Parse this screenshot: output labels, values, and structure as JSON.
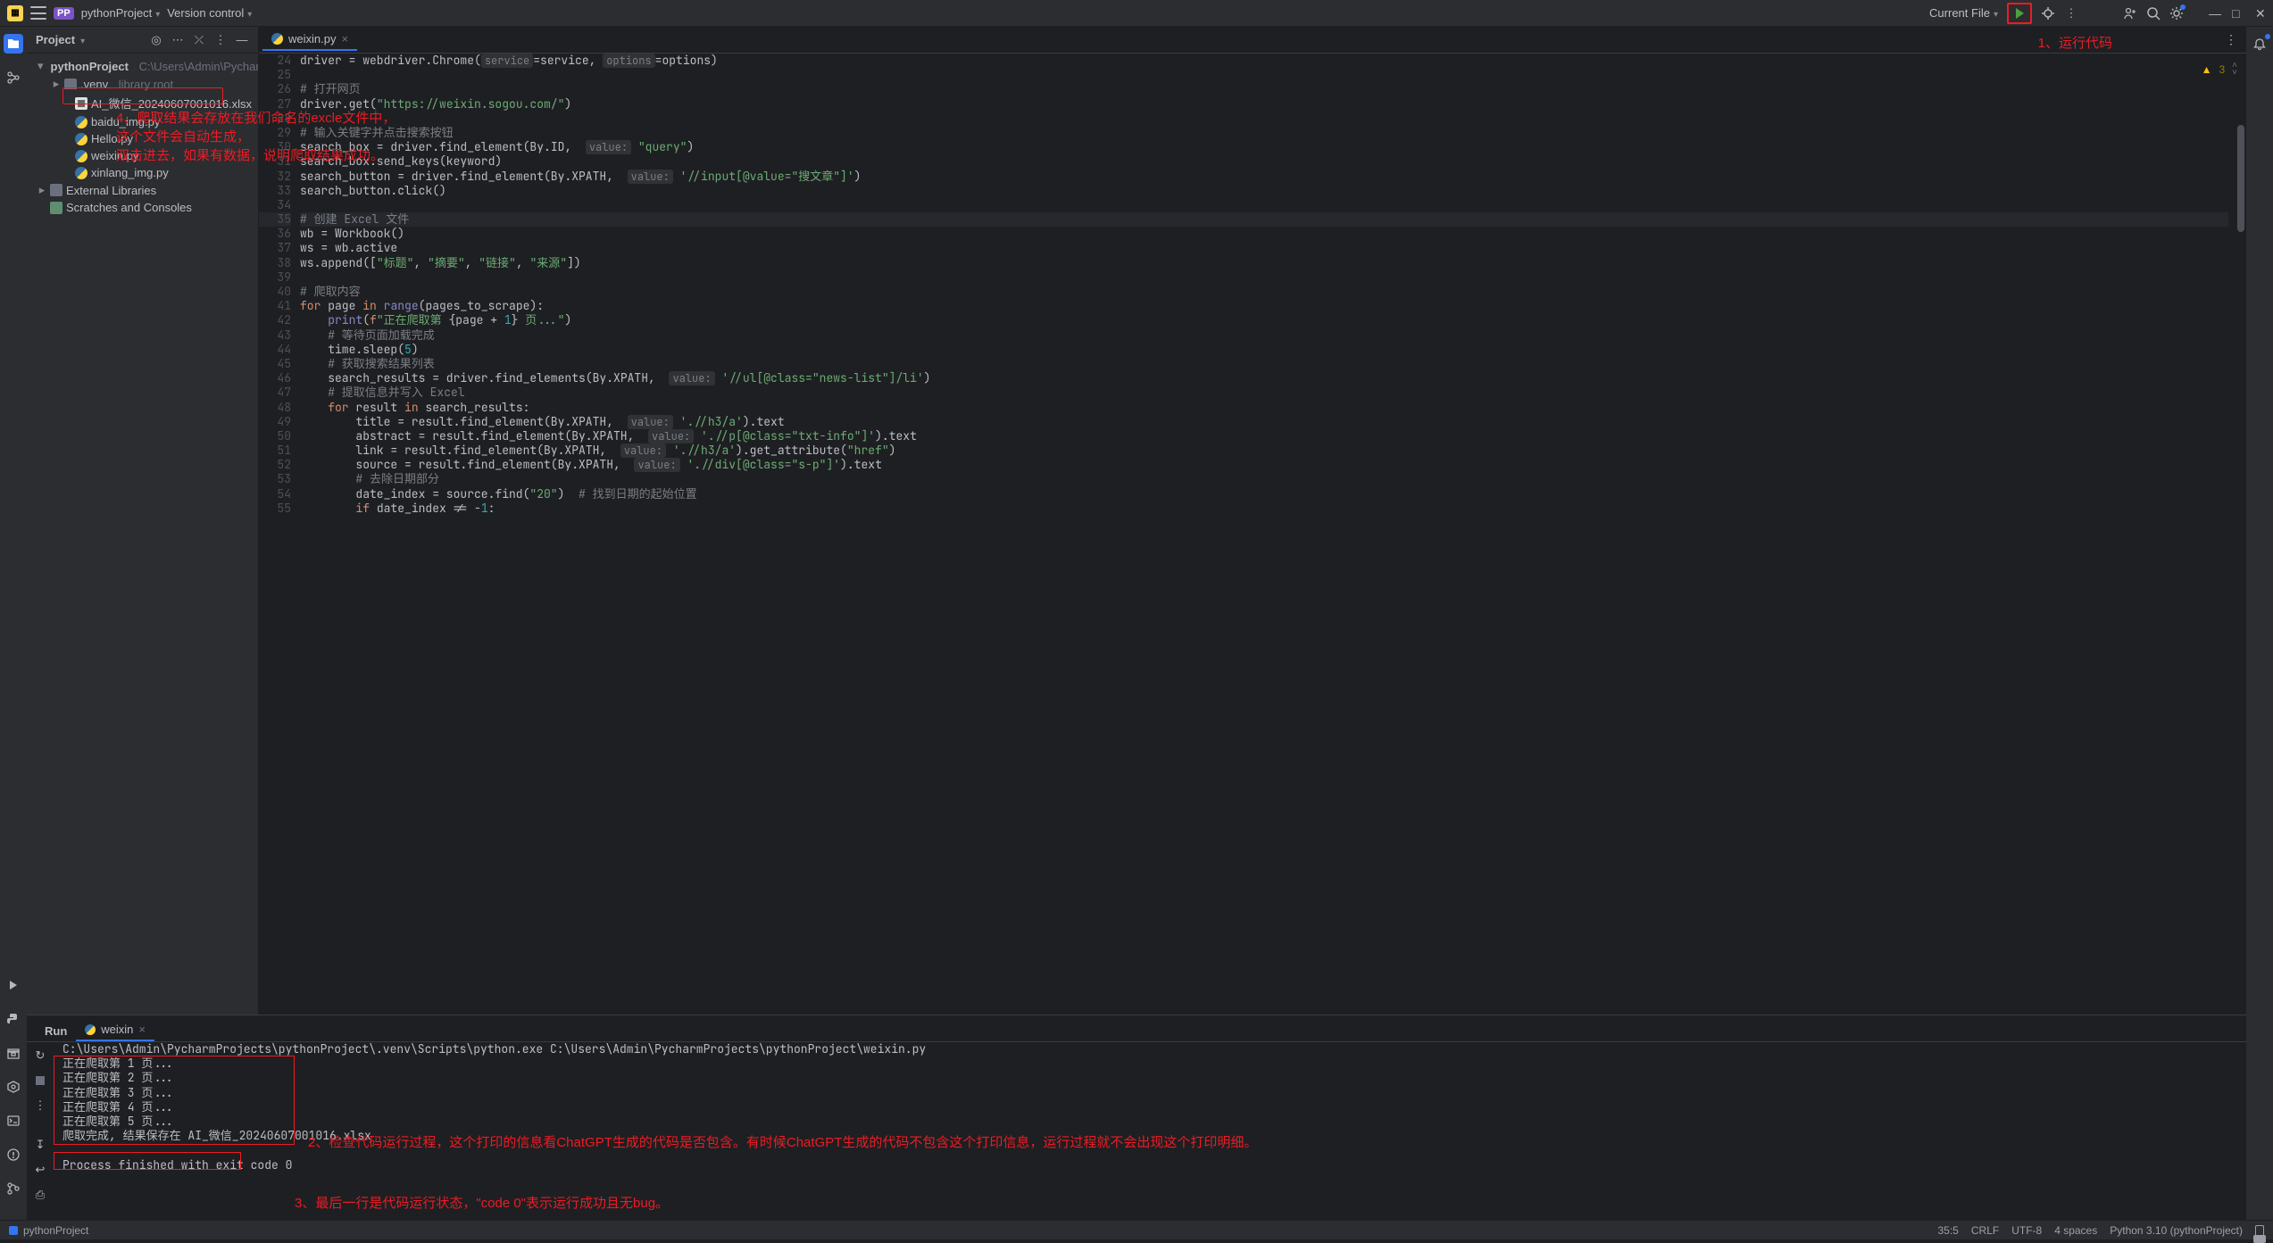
{
  "titlebar": {
    "project_badge": "PP",
    "project_name": "pythonProject",
    "vcs_label": "Version control",
    "run_config": "Current File"
  },
  "annotations": {
    "a1": "1、运行代码",
    "a2": "2、检查代码运行过程，这个打印的信息看ChatGPT生成的代码是否包含。有时候ChatGPT生成的代码不包含这个打印信息，运行过程就不会出现这个打印明细。",
    "a3": "3、最后一行是代码运行状态，\"code 0\"表示运行成功且无bug。",
    "a4_l1": "4、爬取结果会存放在我们命名的excle文件中，",
    "a4_l2": "这个文件会自动生成，",
    "a4_l3": "双击进去，如果有数据，说明爬取结果成功。"
  },
  "project_panel": {
    "title": "Project",
    "root_name": "pythonProject",
    "root_path": "C:\\Users\\Admin\\PycharmPro",
    "items": [
      {
        "type": "folder-venv",
        "name": ".venv",
        "hint": "library root"
      },
      {
        "type": "xlsx",
        "name": "AI_微信_20240607001016.xlsx",
        "highlighted": true
      },
      {
        "type": "py",
        "name": "baidu_img.py"
      },
      {
        "type": "py",
        "name": "Hello.py"
      },
      {
        "type": "py",
        "name": "weixin.py"
      },
      {
        "type": "py",
        "name": "xinlang_img.py"
      }
    ],
    "external_libs": "External Libraries",
    "scratches": "Scratches and Consoles"
  },
  "editor": {
    "tab_name": "weixin.py",
    "warning_count": "3",
    "gutter_start": 24,
    "code_html": [
      "driver = webdriver.Chrome(<span class='tok-hint'>service</span>=service, <span class='tok-hint'>options</span>=options)",
      "",
      "<span class='tok-comment'># 打开网页</span>",
      "driver.get(<span class='tok-str'>\"https://weixin.sogou.com/\"</span>)",
      "",
      "<span class='tok-comment'># 输入关键字并点击搜索按钮</span>",
      "search_box = driver.find_element(By.<span class='tok-param'>ID</span>,  <span class='tok-hint'>value:</span> <span class='tok-str'>\"query\"</span>)",
      "search_box.send_keys(keyword)",
      "search_button = driver.find_element(By.<span class='tok-param'>XPATH</span>,  <span class='tok-hint'>value:</span> <span class='tok-str'>'//input[@value=\"搜文章\"]'</span>)",
      "search_button.click()",
      "",
      "<span class='tok-comment'># 创建 Excel 文件</span>",
      "wb = Workbook()",
      "ws = wb.active",
      "ws.append([<span class='tok-str'>\"标题\"</span>, <span class='tok-str'>\"摘要\"</span>, <span class='tok-str'>\"链接\"</span>, <span class='tok-str'>\"来源\"</span>])",
      "",
      "<span class='tok-comment'># 爬取内容</span>",
      "<span class='tok-kw'>for</span> page <span class='tok-kw'>in</span> <span class='tok-builtin'>range</span>(pages_to_scrape):",
      "    <span class='tok-builtin'>print</span>(<span class='tok-kw'>f</span><span class='tok-str'>\"正在爬取第 </span>{page + <span class='tok-num'>1</span>}<span class='tok-str'> 页...\"</span>)",
      "    <span class='tok-comment'># 等待页面加载完成</span>",
      "    time.sleep(<span class='tok-num'>5</span>)",
      "    <span class='tok-comment'># 获取搜索结果列表</span>",
      "    search_results = driver.find_elements(By.<span class='tok-param'>XPATH</span>,  <span class='tok-hint'>value:</span> <span class='tok-str'>'//ul[@class=\"news-list\"]/li'</span>)",
      "    <span class='tok-comment'># 提取信息并写入 Excel</span>",
      "    <span class='tok-kw'>for</span> result <span class='tok-kw'>in</span> search_results:",
      "        title = result.find_element(By.<span class='tok-param'>XPATH</span>,  <span class='tok-hint'>value:</span> <span class='tok-str'>'.//h3/a'</span>).text",
      "        abstract = result.find_element(By.<span class='tok-param'>XPATH</span>,  <span class='tok-hint'>value:</span> <span class='tok-str'>'.//p[@class=\"txt-info\"]'</span>).text",
      "        link = result.find_element(By.<span class='tok-param'>XPATH</span>,  <span class='tok-hint'>value:</span> <span class='tok-str'>'.//h3/a'</span>).get_attribute(<span class='tok-str'>\"href\"</span>)",
      "        source = result.find_element(By.<span class='tok-param'>XPATH</span>,  <span class='tok-hint'>value:</span> <span class='tok-str'>'.//div[@class=\"s-p\"]'</span>).text",
      "        <span class='tok-comment'># 去除日期部分</span>",
      "        date_index = source.find(<span class='tok-str'>\"20\"</span>)  <span class='tok-comment'># 找到日期的起始位置</span>",
      "        <span class='tok-kw'>if</span> date_index != -<span class='tok-num'>1</span>:"
    ]
  },
  "run_panel": {
    "label": "Run",
    "tab": "weixin",
    "console_lines": [
      "C:\\Users\\Admin\\PycharmProjects\\pythonProject\\.venv\\Scripts\\python.exe C:\\Users\\Admin\\PycharmProjects\\pythonProject\\weixin.py",
      "正在爬取第 1 页...",
      "正在爬取第 2 页...",
      "正在爬取第 3 页...",
      "正在爬取第 4 页...",
      "正在爬取第 5 页...",
      "爬取完成, 结果保存在 AI_微信_20240607001016.xlsx",
      "",
      "Process finished with exit code 0"
    ]
  },
  "statusbar": {
    "project": "pythonProject",
    "cursor": "35:5",
    "line_sep": "CRLF",
    "encoding": "UTF-8",
    "indent": "4 spaces",
    "interpreter": "Python 3.10 (pythonProject)"
  }
}
